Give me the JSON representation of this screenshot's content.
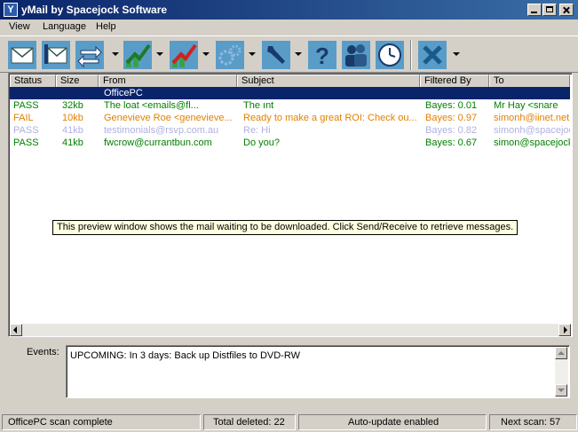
{
  "window": {
    "title": "yMail by Spacejock Software",
    "icon_letter": "Y"
  },
  "menu": [
    "View",
    "Language",
    "Help"
  ],
  "toolbar": [
    {
      "icon": "mail-icon"
    },
    {
      "icon": "mail-download-icon"
    },
    {
      "icon": "send-receive-icon"
    },
    {
      "icon": "green-chart-icon"
    },
    {
      "icon": "red-chart-icon"
    },
    {
      "icon": "gears-icon"
    },
    {
      "icon": "wrench-icon"
    },
    {
      "icon": "help-icon"
    },
    {
      "icon": "users-icon"
    },
    {
      "icon": "clock-icon"
    },
    {
      "icon": "delete-x-icon"
    }
  ],
  "columns": [
    "Status",
    "Size",
    "From",
    "Subject",
    "Filtered By",
    "To"
  ],
  "group_row": "OfficePC",
  "rows": [
    {
      "status": "PASS",
      "size": "32kb",
      "from": "The loat         <emails@fl...",
      "subject": "The ınt",
      "filtered_by": "Bayes: 0.01",
      "to": "Mr Hay <snare",
      "color": "#008000"
    },
    {
      "status": "FAIL",
      "size": "10kb",
      "from": "Genevieve Roe <genevieve...",
      "subject": "Ready to make a great ROI: Check ou...",
      "filtered_by": "Bayes: 0.97",
      "to": "simonh@iinet.net.a",
      "color": "#e08000"
    },
    {
      "status": "PASS",
      "size": "41kb",
      "from": "testimonials@rsvp.com.au",
      "subject": "Re: Hi",
      "filtered_by": "Bayes: 0.82",
      "to": "simonh@spacejock",
      "color": "#b0b0e0"
    },
    {
      "status": "PASS",
      "size": "41kb",
      "from": "fwcrow@currantbun.com",
      "subject": "Do you?",
      "filtered_by": "Bayes: 0.67",
      "to": "simon@spacejock",
      "color": "#008000"
    }
  ],
  "tooltip": "This preview window shows the mail waiting to be downloaded. Click Send/Receive to retrieve messages.",
  "events": {
    "label": "Events:",
    "text": "UPCOMING: In 3 days: Back up Distfiles to DVD-RW"
  },
  "status": {
    "scan": "OfficePC scan complete",
    "deleted": "Total deleted: 22",
    "update": "Auto-update enabled",
    "next": "Next scan: 57"
  }
}
